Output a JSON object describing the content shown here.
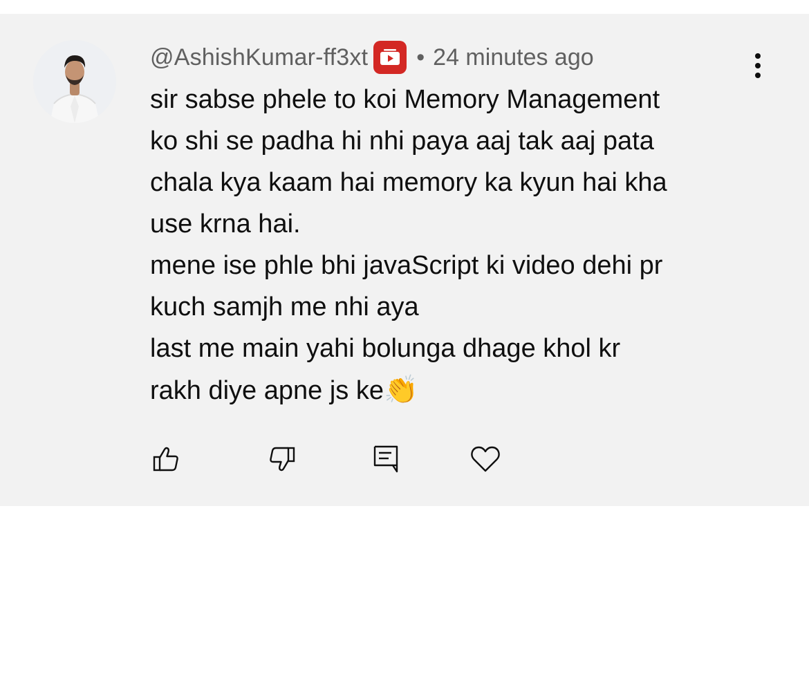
{
  "comment": {
    "author": "@AshishKumar-ff3xt",
    "separator": "•",
    "timestamp": "24 minutes ago",
    "badge_icon": "youtube-member-badge-icon",
    "lines": [
      "sir sabse phele to koi Memory Management",
      "ko shi se padha hi nhi paya aaj tak aaj pata",
      "chala kya kaam hai memory ka kyun hai kha",
      "use krna hai.",
      "mene ise phle bhi javaScript ki video dehi pr",
      "kuch samjh me nhi aya",
      "last me main yahi bolunga dhage khol kr",
      "rakh diye apne js ke"
    ],
    "emoji": "👏"
  },
  "actions": {
    "like_icon": "thumbs-up-icon",
    "dislike_icon": "thumbs-down-icon",
    "reply_icon": "reply-icon",
    "heart_icon": "heart-icon",
    "more_icon": "more-vertical-icon"
  },
  "colors": {
    "card_background": "#f2f2f2",
    "badge_red": "#d32824",
    "meta_text": "#606060",
    "body_text": "#0f0f0f"
  }
}
